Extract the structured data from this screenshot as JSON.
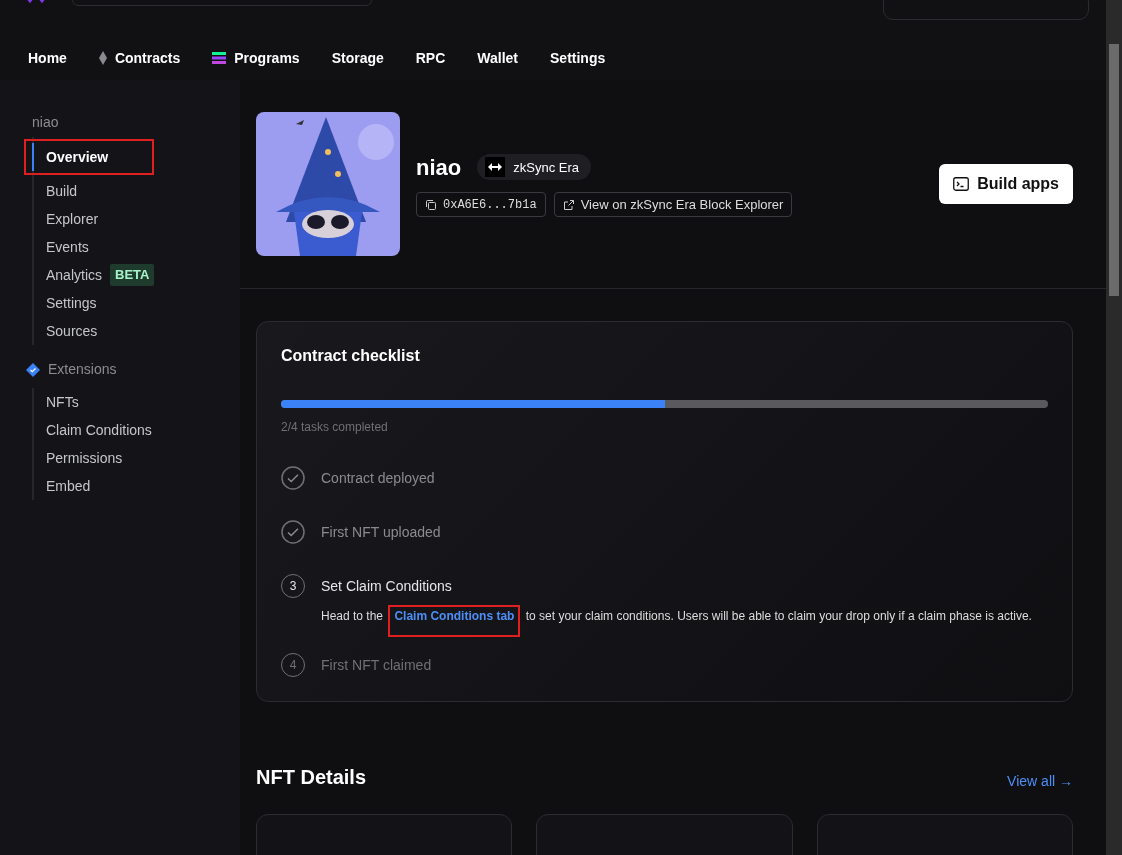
{
  "topnav": [
    {
      "label": "Home"
    },
    {
      "label": "Contracts"
    },
    {
      "label": "Programs"
    },
    {
      "label": "Storage"
    },
    {
      "label": "RPC"
    },
    {
      "label": "Wallet"
    },
    {
      "label": "Settings"
    }
  ],
  "sidebar": {
    "heading": "niao",
    "items": [
      {
        "label": "Overview",
        "selected": true,
        "highlighted": true
      },
      {
        "label": "Build",
        "selected": false,
        "highlighted": false
      },
      {
        "label": "Explorer",
        "selected": false,
        "highlighted": false
      },
      {
        "label": "Events",
        "selected": false,
        "highlighted": false
      },
      {
        "label": "Analytics",
        "selected": false,
        "highlighted": false,
        "badge": "BETA"
      },
      {
        "label": "Settings",
        "selected": false,
        "highlighted": false
      },
      {
        "label": "Sources",
        "selected": false,
        "highlighted": false
      }
    ],
    "extensions_heading": "Extensions",
    "extensions": [
      {
        "label": "NFTs",
        "selected": false
      },
      {
        "label": "Claim Conditions",
        "selected": false
      },
      {
        "label": "Permissions",
        "selected": false
      },
      {
        "label": "Embed",
        "selected": false
      }
    ]
  },
  "contract": {
    "name": "niao",
    "chain": "zkSync Era",
    "address": "0xA6E6...7b1a",
    "explorer_link": "View on zkSync Era Block Explorer",
    "build_button": "Build apps"
  },
  "checklist": {
    "title": "Contract checklist",
    "level": 0.5,
    "progress_text": "2/4 tasks completed",
    "steps": [
      {
        "kind": "done",
        "title": "Contract deployed"
      },
      {
        "kind": "done",
        "title": "First NFT uploaded"
      },
      {
        "kind": "current",
        "number": "3",
        "title": "Set Claim Conditions",
        "text_before": "Head to the",
        "link": "Claim Conditions tab",
        "link_highlighted": true,
        "text_after": "to set your claim conditions. Users will be able to claim your drop only if a claim phase is active."
      },
      {
        "kind": "todo",
        "number": "4",
        "title": "First NFT claimed"
      }
    ]
  },
  "nft_details": {
    "title": "NFT Details",
    "view_all": "View all →"
  }
}
